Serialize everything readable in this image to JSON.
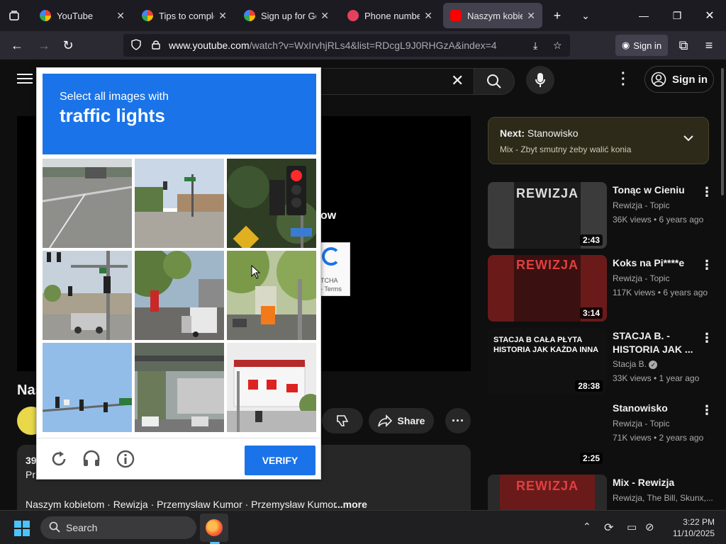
{
  "browser": {
    "tabs": [
      {
        "label": "YouTube",
        "active": false,
        "favicon_color": "#ffffff"
      },
      {
        "label": "Tips to complete",
        "active": false,
        "favicon_color": "#ffffff"
      },
      {
        "label": "Sign up for Goog",
        "active": false,
        "favicon_color": "#ffffff"
      },
      {
        "label": "Phone numbers",
        "active": false,
        "favicon_color": "#e4405f"
      },
      {
        "label": "Naszym kobieto",
        "active": true,
        "favicon_color": "#ff0000"
      }
    ],
    "url_host": "www.youtube.com",
    "url_path": "/watch?v=WxIrvhjRLs4&list=RDcgL9J0RHGzA&index=4",
    "sign_in_label": "Sign in"
  },
  "youtube": {
    "sign_in_label": "Sign in",
    "video_title_fragment": "Nas",
    "player_text_fragment": "ow",
    "views_fragment": "39",
    "desc_fragment": "Pr",
    "desc_tags": "Naszym kobietom · Rewizja · Przemysław Kumor · Przemysław Kumor",
    "more_label": "...more",
    "share_label": "Share",
    "next": {
      "prefix": "Next:",
      "title": "Stanowisko",
      "subtitle": "Mix - Zbyt smutny żeby walić konia"
    },
    "recommendations": [
      {
        "title": "Tonąc w Cieniu",
        "channel": "Rewizja - Topic",
        "meta": "36K views • 6 years ago",
        "duration": "2:43",
        "thumb_text": "REWIZJA",
        "thumb_color": "#2e2e2e"
      },
      {
        "title": "Koks na Pi****e",
        "channel": "Rewizja - Topic",
        "meta": "117K views • 6 years ago",
        "duration": "3:14",
        "thumb_text": "REWIZJA",
        "thumb_color": "#5b1414"
      },
      {
        "title": "STACJA B. - HISTORIA JAK ...",
        "channel": "Stacja B.",
        "meta": "33K views • 1 year ago",
        "duration": "28:38",
        "thumb_text": "STACJA B  CAŁA PŁYTA  HISTORIA JAK KAŻDA INNA",
        "thumb_color": "#111111"
      },
      {
        "title": "Stanowisko",
        "channel": "Rewizja - Topic",
        "meta": "71K views • 2 years ago",
        "duration": "2:25",
        "thumb_text": "",
        "thumb_color": "#0f0f0f"
      },
      {
        "title": "Mix - Rewizja",
        "channel": "Rewizja, The Bill, Skunx,...",
        "meta": "",
        "duration": "",
        "thumb_text": "REWIZJA",
        "thumb_color": "#5b1414"
      }
    ]
  },
  "captcha": {
    "instruction": "Select all images with",
    "target": "traffic lights",
    "verify_label": "VERIFY",
    "badge_text": "TCHA",
    "badge_terms": "- Terms",
    "tiles": [
      {
        "sky": "#cfd4d6",
        "ground": "#8f8f8c"
      },
      {
        "sky": "#c7d5e3",
        "ground": "#a7a39b"
      },
      {
        "sky": "#2d3a22",
        "ground": "#3b4a2c"
      },
      {
        "sky": "#c4cfdb",
        "ground": "#9b9a94"
      },
      {
        "sky": "#9fb6c9",
        "ground": "#6f7a5e"
      },
      {
        "sky": "#c9d4b3",
        "ground": "#707768"
      },
      {
        "sky": "#8fb7e6",
        "ground": "#a7c4e8"
      },
      {
        "sky": "#9fa8a8",
        "ground": "#5f6a5c"
      },
      {
        "sky": "#e8e8e8",
        "ground": "#b7b7b7"
      }
    ]
  },
  "taskbar": {
    "search_label": "Search",
    "time": "3:22 PM",
    "date": "11/10/2025"
  }
}
